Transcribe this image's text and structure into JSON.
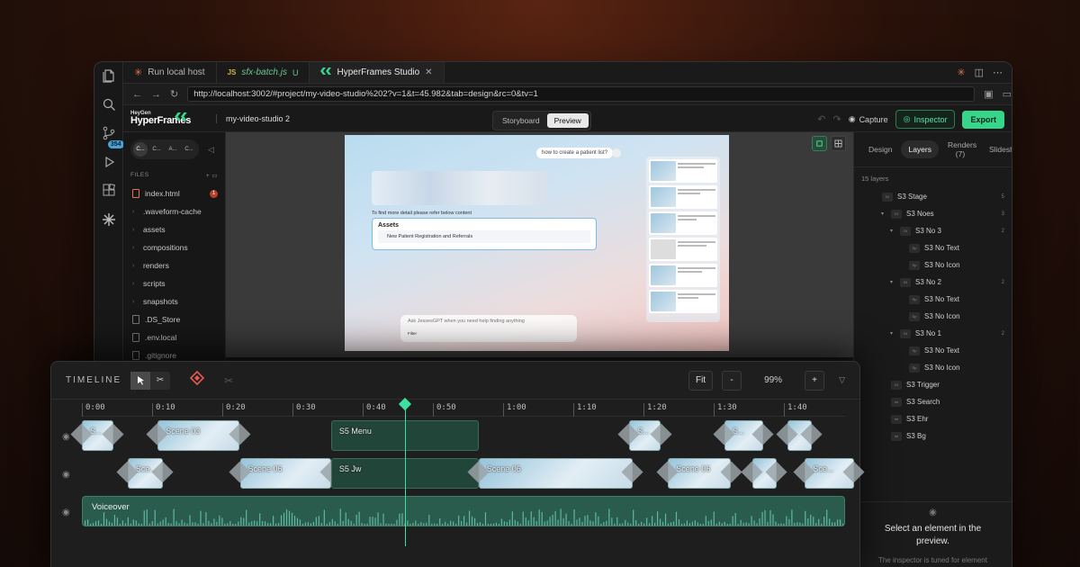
{
  "tabs": [
    {
      "label": "Run local host"
    },
    {
      "label": "sfx-batch.js",
      "modified": "U",
      "prefix": "JS"
    },
    {
      "label": "HyperFrames Studio",
      "active": true
    }
  ],
  "address": {
    "url": "http://localhost:3002/#project/my-video-studio%202?v=1&t=45.982&tab=design&rc=0&tv=1"
  },
  "activity": {
    "badge": "354"
  },
  "header": {
    "logo_small": "HeyGen",
    "logo_big": "HyperFrames",
    "project": "my-video-studio 2",
    "views": [
      "Storyboard",
      "Preview"
    ],
    "active_view": "Preview",
    "capture": "Capture",
    "inspector": "Inspector",
    "export": "Export"
  },
  "sidebar": {
    "comps": [
      "C...",
      "C...",
      "A...",
      "C..."
    ],
    "files_label": "FILES",
    "files": [
      {
        "name": "index.html",
        "type": "html",
        "count": "1"
      },
      {
        "name": ".waveform-cache",
        "type": "folder"
      },
      {
        "name": "assets",
        "type": "folder"
      },
      {
        "name": "compositions",
        "type": "folder"
      },
      {
        "name": "renders",
        "type": "folder"
      },
      {
        "name": "scripts",
        "type": "folder"
      },
      {
        "name": "snapshots",
        "type": "folder"
      },
      {
        "name": ".DS_Store",
        "type": "file"
      },
      {
        "name": ".env.local",
        "type": "file"
      },
      {
        "name": ".gitignore",
        "type": "file"
      }
    ]
  },
  "preview": {
    "question": "how to create a patient list?",
    "detail": "To find more detail please refer below content",
    "assets_title": "Assets",
    "assets_item": "New Patient Registration and Referrals",
    "ask_placeholder": "Ask JessesGPT when you need help finding anything",
    "ask_filter": "Filter"
  },
  "right_panel": {
    "tabs": [
      "Design",
      "Layers",
      "Renders (7)",
      "Slidesh"
    ],
    "active_tab": "Layers",
    "layer_count": "15 layers",
    "layers": [
      {
        "name": "S3 Stage",
        "depth": 0,
        "chev": "",
        "icon": "Di",
        "num": "5"
      },
      {
        "name": "S3 Noes",
        "depth": 1,
        "chev": "▾",
        "icon": "Di",
        "num": "3"
      },
      {
        "name": "S3 No 3",
        "depth": 2,
        "chev": "▾",
        "icon": "Di",
        "num": "2"
      },
      {
        "name": "S3 No Text",
        "depth": 3,
        "chev": "",
        "icon": "Sp",
        "num": ""
      },
      {
        "name": "S3 No Icon",
        "depth": 3,
        "chev": "",
        "icon": "Sp",
        "num": ""
      },
      {
        "name": "S3 No 2",
        "depth": 2,
        "chev": "▾",
        "icon": "Di",
        "num": "2"
      },
      {
        "name": "S3 No Text",
        "depth": 3,
        "chev": "",
        "icon": "Sp",
        "num": ""
      },
      {
        "name": "S3 No Icon",
        "depth": 3,
        "chev": "",
        "icon": "Sp",
        "num": ""
      },
      {
        "name": "S3 No 1",
        "depth": 2,
        "chev": "▾",
        "icon": "Di",
        "num": "2"
      },
      {
        "name": "S3 No Text",
        "depth": 3,
        "chev": "",
        "icon": "Sp",
        "num": ""
      },
      {
        "name": "S3 No Icon",
        "depth": 3,
        "chev": "",
        "icon": "Sp",
        "num": ""
      },
      {
        "name": "S3 Trigger",
        "depth": 1,
        "chev": "",
        "icon": "Di",
        "num": ""
      },
      {
        "name": "S3 Search",
        "depth": 1,
        "chev": "",
        "icon": "Im",
        "num": ""
      },
      {
        "name": "S3 Ehr",
        "depth": 1,
        "chev": "",
        "icon": "Im",
        "num": ""
      },
      {
        "name": "S3 Bg",
        "depth": 1,
        "chev": "",
        "icon": "Im",
        "num": ""
      }
    ],
    "empty_title": "Select an element in the preview.",
    "empty_sub": "The inspector is tuned for element"
  },
  "timeline": {
    "title": "TIMELINE",
    "fit": "Fit",
    "minus": "-",
    "zoom": "99%",
    "plus": "+",
    "ticks": [
      "0:00",
      "0:10",
      "0:20",
      "0:30",
      "0:40",
      "0:50",
      "1:00",
      "1:10",
      "1:20",
      "1:30",
      "1:40"
    ],
    "track1": [
      {
        "label": "S...",
        "start": 0,
        "end": 4.5,
        "kind": "thumb"
      },
      {
        "label": "Scene 03",
        "start": 10.8,
        "end": 22.5,
        "kind": "thumb"
      },
      {
        "label": "S5 Menu",
        "start": 35.5,
        "end": 56.5,
        "kind": "green"
      },
      {
        "label": "S...",
        "start": 78,
        "end": 82.5,
        "kind": "thumb"
      },
      {
        "label": "S...",
        "start": 91.5,
        "end": 97,
        "kind": "thumb"
      },
      {
        "label": "",
        "start": 100.5,
        "end": 104,
        "kind": "thumb"
      }
    ],
    "track2": [
      {
        "label": "Sce...",
        "start": 6.5,
        "end": 11.5,
        "kind": "thumb"
      },
      {
        "label": "Scene 06",
        "start": 22.5,
        "end": 35.5,
        "kind": "thumb"
      },
      {
        "label": "S5 Jw",
        "start": 35.5,
        "end": 56.5,
        "kind": "green"
      },
      {
        "label": "Scene 06",
        "start": 56.5,
        "end": 78.5,
        "kind": "thumb"
      },
      {
        "label": "Scene 06",
        "start": 83.5,
        "end": 92.5,
        "kind": "thumb"
      },
      {
        "label": "",
        "start": 95.5,
        "end": 99,
        "kind": "thumb"
      },
      {
        "label": "Sce...",
        "start": 103,
        "end": 110,
        "kind": "thumb"
      }
    ],
    "voiceover": "Voiceover",
    "playhead_seconds": 45.982
  },
  "colors": {
    "accent": "#36d68a",
    "playhead": "#3ee0a0"
  }
}
